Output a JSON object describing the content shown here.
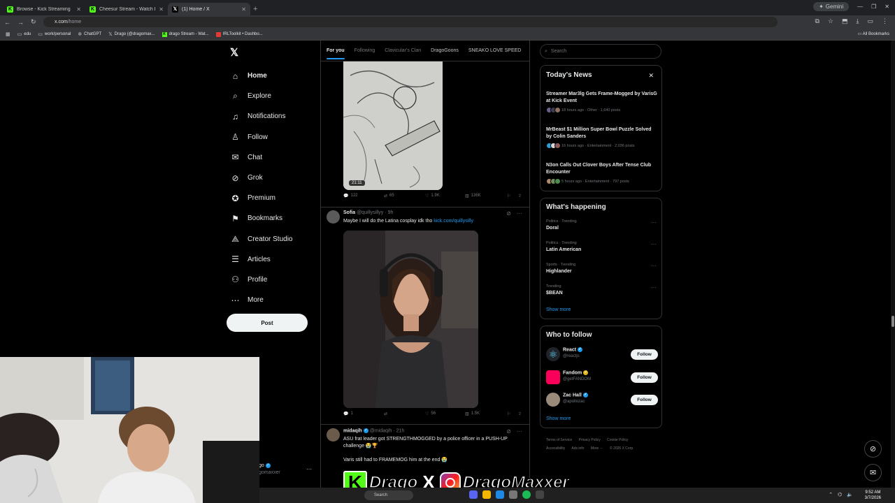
{
  "browser": {
    "tabs": [
      {
        "title": "Browse - Kick Streaming",
        "favicon": "kick-icon"
      },
      {
        "title": "Cheesur Stream - Watch Live o",
        "favicon": "kick-icon"
      },
      {
        "title": "(1) Home / X",
        "favicon": "x-icon",
        "active": true
      }
    ],
    "gemini_label": "Gemini",
    "url_host": "x.com",
    "url_path": "/home",
    "bookmarks": [
      "edu",
      "work/personal",
      "ChatGPT",
      "Drago (@dragomax...",
      "drago Stream - Wat...",
      "IRLToolkit • Dashbo..."
    ],
    "all_bookmarks": "All Bookmarks"
  },
  "sidebar": {
    "items": [
      {
        "label": "Home",
        "icon": "home-icon",
        "glyph": "⌂"
      },
      {
        "label": "Explore",
        "icon": "search-icon",
        "glyph": "⌕"
      },
      {
        "label": "Notifications",
        "icon": "bell-icon",
        "glyph": "🔔"
      },
      {
        "label": "Follow",
        "icon": "follow-icon",
        "glyph": "👤"
      },
      {
        "label": "Chat",
        "icon": "chat-icon",
        "glyph": "✉"
      },
      {
        "label": "Grok",
        "icon": "grok-icon",
        "glyph": "⊘"
      },
      {
        "label": "Premium",
        "icon": "premium-icon",
        "glyph": "✪"
      },
      {
        "label": "Bookmarks",
        "icon": "bookmark-icon",
        "glyph": "🔖"
      },
      {
        "label": "Creator Studio",
        "icon": "creator-icon",
        "glyph": "⟁"
      },
      {
        "label": "Articles",
        "icon": "articles-icon",
        "glyph": "☰"
      },
      {
        "label": "Profile",
        "icon": "profile-icon",
        "glyph": "⚇"
      },
      {
        "label": "More",
        "icon": "more-icon",
        "glyph": "⋯"
      }
    ],
    "post_label": "Post",
    "account_name": "go",
    "account_handle": "gomaxxer"
  },
  "feed": {
    "tabs": [
      "For you",
      "Following",
      "Clavicular's Clan",
      "DragoGoons",
      "SNEAKO LOVE SPEED"
    ],
    "post1": {
      "duration": "21:11",
      "replies": "122",
      "reposts": "65",
      "likes": "1.9K",
      "views": "136K"
    },
    "post2": {
      "name": "Sofia",
      "handle": "@quillysillyy",
      "time": "9h",
      "text": "Maybe I will do the Latina cosplay idk tho ",
      "link": "kick.com/quillysilly",
      "replies": "1",
      "reposts": "",
      "likes": "56",
      "views": "1.5K"
    },
    "post3": {
      "name": "midaqih",
      "handle": "@midaqih",
      "time": "21h",
      "text": "ASU frat leader got STRENGTHMOGGED by a police officer in a PUSH-UP challenge 😭🏆",
      "text2": "Varis still had to FRAMEMOG him at the end 😭"
    }
  },
  "right": {
    "search_placeholder": "Search",
    "news": {
      "title": "Today's News",
      "items": [
        {
          "headline": "Streamer Mar3lg Gets Frame-Mogged by VarisG at Kick Event",
          "meta": "18 hours ago · Other · 1,640 posts"
        },
        {
          "headline": "MrBeast $1 Million Super Bowl Puzzle Solved by Colin Sanders",
          "meta": "16 hours ago · Entertainment · 2,036 posts"
        },
        {
          "headline": "N3on Calls Out Clover Boys After Tense Club Encounter",
          "meta": "5 hours ago · Entertainment · 797 posts"
        }
      ]
    },
    "happening": {
      "title": "What's happening",
      "items": [
        {
          "category": "Politics · Trending",
          "name": "Doral"
        },
        {
          "category": "Politics · Trending",
          "name": "Latin American"
        },
        {
          "category": "Sports · Trending",
          "name": "Highlander"
        },
        {
          "category": "Trending",
          "name": "$BEAN"
        }
      ],
      "show_more": "Show more"
    },
    "who_to_follow": {
      "title": "Who to follow",
      "items": [
        {
          "name": "React",
          "handle": "@reactjs",
          "badge": "blue"
        },
        {
          "name": "Fandom",
          "handle": "@getFANDOM",
          "badge": "gold"
        },
        {
          "name": "Zac Hall",
          "handle": "@apollozac",
          "badge": "blue"
        }
      ],
      "follow_label": "Follow",
      "show_more": "Show more"
    },
    "footer": [
      "Terms of Service",
      "Privacy Policy",
      "Cookie Policy",
      "Accessibility",
      "Ads info",
      "More ···",
      "© 2026 X Corp."
    ]
  },
  "overlay": {
    "kick_letter": "K",
    "name1": "Drago",
    "x_letter": "X",
    "name2": "DragoMaxxer"
  },
  "taskbar": {
    "search_label": "Search",
    "time": "9:52 AM",
    "date": "3/7/2026"
  },
  "colors": {
    "accent": "#1d9bf0",
    "kick": "#53fc18",
    "border": "#2f3336"
  }
}
